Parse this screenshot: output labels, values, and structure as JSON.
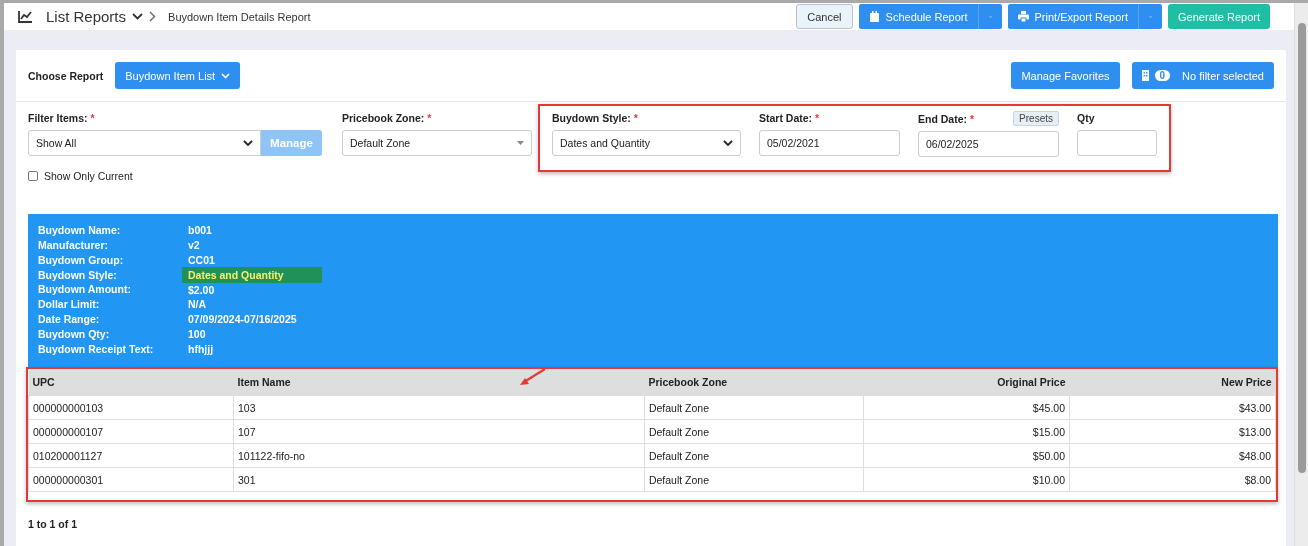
{
  "topbar": {
    "title": "List Reports",
    "breadcrumb": "Buydown Item Details Report",
    "buttons": [
      {
        "label": "Cancel",
        "kind": "plain"
      },
      {
        "label": "Schedule Report",
        "kind": "schedule"
      },
      {
        "label": "Print/Export Report",
        "kind": "print"
      },
      {
        "label": "Generate Report",
        "kind": "primary"
      }
    ]
  },
  "report_bar": {
    "label": "Choose Report",
    "report": "Buydown Item List",
    "favorites": "Manage Favorites",
    "filter_count": "0",
    "filter_text": "No filter selected"
  },
  "filters": {
    "filter_items": {
      "label": "Filter Items:",
      "required": "*",
      "value": "Show All",
      "button": "Manage"
    },
    "pricebook_zone": {
      "label": "Pricebook Zone:",
      "required": "*",
      "value": "Default Zone"
    },
    "show_only_current": {
      "label": "Show Only Current",
      "checked": false
    },
    "buydown_style": {
      "label": "Buydown Style:",
      "required": "*",
      "value": "Dates and Quantity"
    },
    "start_date": {
      "label": "Start Date:",
      "required": "*",
      "value": "05/02/2021"
    },
    "end_date": {
      "label": "End Date:",
      "required": "*",
      "value": "06/02/2025",
      "presets": "Presets"
    },
    "qty": {
      "label": "Qty"
    }
  },
  "details": [
    {
      "label": "Buydown Name:",
      "value": "b001",
      "highlighted": false
    },
    {
      "label": "Manufacturer:",
      "value": "v2",
      "highlighted": false
    },
    {
      "label": "Buydown Group:",
      "value": "CC01",
      "highlighted": false
    },
    {
      "label": "Buydown Style:",
      "value": "Dates and Quantity",
      "highlighted": true
    },
    {
      "label": "Buydown Amount:",
      "value": "$2.00",
      "highlighted": false
    },
    {
      "label": "Dollar Limit:",
      "value": "N/A",
      "highlighted": false
    },
    {
      "label": "Date Range:",
      "value": "07/09/2024-07/16/2025",
      "highlighted": false
    },
    {
      "label": "Buydown Qty:",
      "value": "100",
      "highlighted": false
    },
    {
      "label": "Buydown Receipt Text:",
      "value": "hfhjjj",
      "highlighted": false
    }
  ],
  "table": {
    "columns": [
      {
        "label": "UPC",
        "kind": "text"
      },
      {
        "label": "Item Name",
        "kind": "text"
      },
      {
        "label": "Pricebook Zone",
        "kind": "text"
      },
      {
        "label": "Original Price",
        "kind": "money"
      },
      {
        "label": "New Price",
        "kind": "money"
      }
    ],
    "rows": [
      [
        "000000000103",
        "103",
        "Default Zone",
        "$45.00",
        "$43.00"
      ],
      [
        "000000000107",
        "107",
        "Default Zone",
        "$15.00",
        "$13.00"
      ],
      [
        "010200001127",
        "101122-fifo-no",
        "Default Zone",
        "$50.00",
        "$48.00"
      ],
      [
        "000000000301",
        "301",
        "Default Zone",
        "$10.00",
        "$8.00"
      ]
    ]
  },
  "pager": "1 to 1 of 1"
}
